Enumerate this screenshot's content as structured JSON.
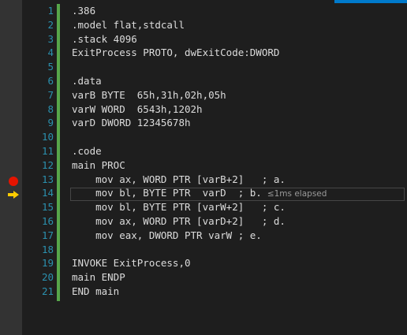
{
  "editor": {
    "line_numbers": [
      "1",
      "2",
      "3",
      "4",
      "5",
      "6",
      "7",
      "8",
      "9",
      "10",
      "11",
      "12",
      "13",
      "14",
      "15",
      "16",
      "17",
      "18",
      "19",
      "20",
      "21"
    ],
    "code_lines": [
      ".386",
      ".model flat,stdcall",
      ".stack 4096",
      "ExitProcess PROTO, dwExitCode:DWORD",
      "",
      ".data",
      "varB BYTE  65h,31h,02h,05h",
      "varW WORD  6543h,1202h",
      "varD DWORD 12345678h",
      "",
      ".code",
      "main PROC",
      "    mov ax, WORD PTR [varB+2]   ; a.",
      "    mov bl, BYTE PTR  varD  ; b.",
      "    mov bl, BYTE PTR [varW+2]   ; c.",
      "    mov ax, WORD PTR [varD+2]   ; d.",
      "    mov eax, DWORD PTR varW ; e.",
      "",
      "INVOKE ExitProcess,0",
      "main ENDP",
      "END main"
    ],
    "perf_tip": "≤1ms elapsed",
    "breakpoint_line": 13,
    "current_line": 14
  },
  "colors": {
    "background": "#1e1e1e",
    "glyph_margin": "#333333",
    "line_number": "#2b91af",
    "change_bar": "#57a64a",
    "breakpoint": "#e51400",
    "exec_arrow": "#ffcc00",
    "accent": "#007acc"
  },
  "icons": {
    "breakpoint": "breakpoint-icon",
    "execution_pointer": "execution-pointer-icon"
  }
}
